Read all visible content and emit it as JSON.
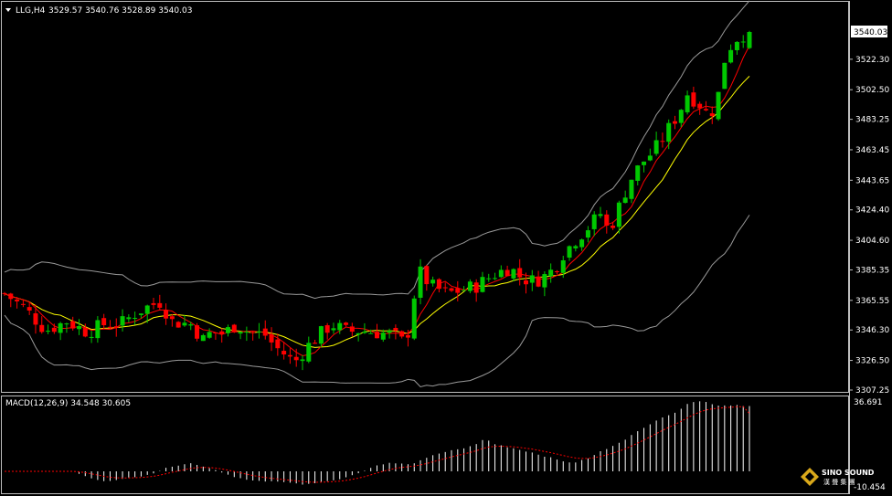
{
  "header": {
    "symbol": "LLG,H4",
    "ohlc": "3529.57 3540.76 3528.89 3540.03"
  },
  "macd": {
    "label": "MACD(12,26,9) 34.548 30.605",
    "axis_top": "36.691",
    "axis_bottom": "-10.454"
  },
  "price_axis": {
    "current": "3540.03",
    "ticks": [
      "3522.30",
      "3502.50",
      "3483.25",
      "3463.45",
      "3443.65",
      "3424.40",
      "3404.60",
      "3385.35",
      "3365.55",
      "3346.30",
      "3326.50",
      "3307.25"
    ]
  },
  "logo": {
    "line1": "SINO SOUND",
    "line2": "漢 聲 集 團"
  },
  "colors": {
    "bull": "#00c800",
    "bear": "#ff0000",
    "band": "#9a9a9a",
    "ma_fast": "#ff0000",
    "ma_slow": "#ffff00",
    "signal": "#ff0000",
    "hist": "#ffffff"
  },
  "chart_data": [
    {
      "type": "candlestick",
      "title": "LLG,H4",
      "ylim": [
        3307.25,
        3550
      ],
      "y_ticks": [
        3540.03,
        3522.3,
        3502.5,
        3483.25,
        3463.45,
        3443.65,
        3424.4,
        3404.6,
        3385.35,
        3365.55,
        3346.3,
        3326.5,
        3307.25
      ],
      "close_path": [
        [
          0,
          3370
        ],
        [
          10,
          3360
        ],
        [
          20,
          3346
        ],
        [
          30,
          3352
        ],
        [
          40,
          3345
        ],
        [
          48,
          3350
        ],
        [
          56,
          3350
        ],
        [
          64,
          3358
        ],
        [
          70,
          3362
        ],
        [
          76,
          3365
        ],
        [
          80,
          3352
        ],
        [
          90,
          3350
        ],
        [
          96,
          3340
        ],
        [
          100,
          3345
        ],
        [
          106,
          3344
        ],
        [
          112,
          3350
        ],
        [
          118,
          3345
        ],
        [
          126,
          3343
        ],
        [
          131,
          3335
        ],
        [
          136,
          3330
        ],
        [
          140,
          3325
        ],
        [
          146,
          3335
        ],
        [
          152,
          3343
        ],
        [
          158,
          3350
        ],
        [
          166,
          3345
        ],
        [
          172,
          3346
        ],
        [
          178,
          3345
        ],
        [
          184,
          3344
        ],
        [
          188,
          3343
        ],
        [
          194,
          3337
        ],
        [
          200,
          3385
        ],
        [
          206,
          3375
        ],
        [
          214,
          3370
        ],
        [
          220,
          3372
        ],
        [
          228,
          3375
        ],
        [
          236,
          3382
        ],
        [
          244,
          3387
        ],
        [
          250,
          3380
        ],
        [
          256,
          3378
        ],
        [
          262,
          3382
        ],
        [
          266,
          3387
        ],
        [
          270,
          3396
        ],
        [
          276,
          3405
        ],
        [
          282,
          3413
        ],
        [
          288,
          3422
        ],
        [
          292,
          3410
        ],
        [
          296,
          3423
        ],
        [
          302,
          3443
        ],
        [
          308,
          3455
        ],
        [
          314,
          3463
        ],
        [
          320,
          3475
        ],
        [
          326,
          3488
        ],
        [
          330,
          3500
        ],
        [
          336,
          3493
        ],
        [
          340,
          3486
        ],
        [
          344,
          3492
        ],
        [
          348,
          3522
        ],
        [
          352,
          3534
        ],
        [
          356,
          3538
        ],
        [
          360,
          3540.03
        ]
      ],
      "series_notes": "Bollinger bands (gray), red fast MA, yellow slow MA overlaid on candles"
    },
    {
      "type": "macd",
      "label": "MACD(12,26,9)",
      "values": {
        "macd": 34.548,
        "signal": 30.605
      },
      "ylim": [
        -10.454,
        36.691
      ]
    }
  ]
}
